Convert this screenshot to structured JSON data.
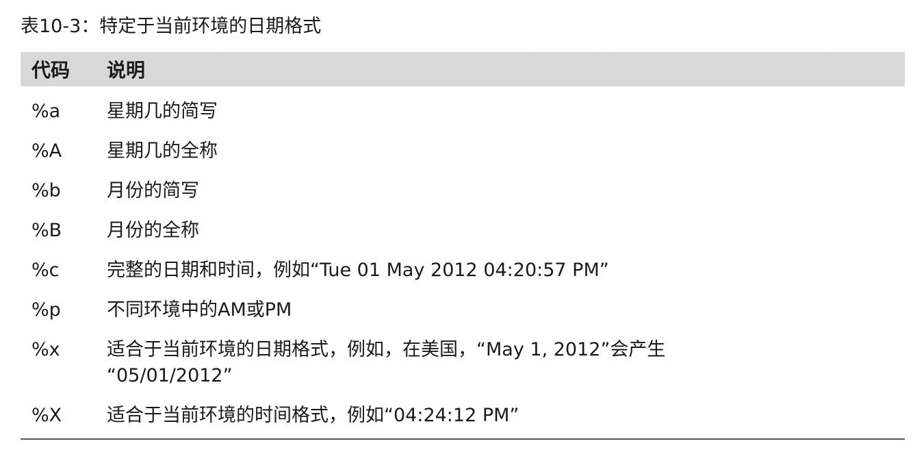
{
  "caption": "表10-3：特定于当前环境的日期格式",
  "table": {
    "headers": {
      "code": "代码",
      "description": "说明"
    },
    "rows": [
      {
        "code": "%a",
        "description": "星期几的简写"
      },
      {
        "code": "%A",
        "description": "星期几的全称"
      },
      {
        "code": "%b",
        "description": "月份的简写"
      },
      {
        "code": "%B",
        "description": "月份的全称"
      },
      {
        "code": "%c",
        "description": "完整的日期和时间，例如“Tue 01 May 2012 04:20:57 PM”"
      },
      {
        "code": "%p",
        "description": "不同环境中的AM或PM"
      },
      {
        "code": "%x",
        "description": "适合于当前环境的日期格式，例如，在美国，“May 1, 2012”会产生\n“05/01/2012”"
      },
      {
        "code": "%X",
        "description": "适合于当前环境的时间格式，例如“04:24:12 PM”"
      }
    ]
  }
}
